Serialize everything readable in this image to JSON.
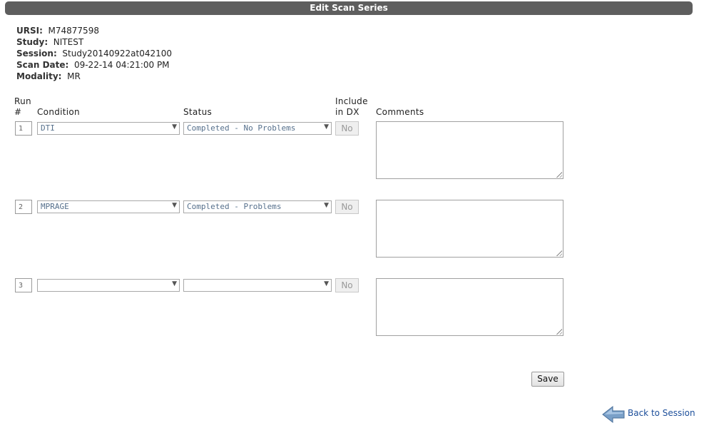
{
  "title": "Edit Scan Series",
  "info": [
    {
      "label": "URSI:",
      "value": "M74877598"
    },
    {
      "label": "Study:",
      "value": "NITEST"
    },
    {
      "label": "Session:",
      "value": "Study20140922at042100"
    },
    {
      "label": "Scan Date:",
      "value": "09-22-14 04:21:00 PM"
    },
    {
      "label": "Modality:",
      "value": "MR"
    }
  ],
  "headers": {
    "run_line1": "Run",
    "run_line2": "#",
    "condition": "Condition",
    "status": "Status",
    "include_line1": "Include",
    "include_line2": "in DX",
    "comments": "Comments"
  },
  "rows": [
    {
      "run": "1",
      "condition": "DTI",
      "status": "Completed - No Problems",
      "include": "No",
      "comments": ""
    },
    {
      "run": "2",
      "condition": "MPRAGE",
      "status": "Completed - Problems",
      "include": "No",
      "comments": ""
    },
    {
      "run": "3",
      "condition": "",
      "status": "",
      "include": "No",
      "comments": ""
    }
  ],
  "save_label": "Save",
  "back_label": "Back to Session",
  "icons": {
    "dropdown": "chevron-down-icon",
    "back": "back-arrow-icon"
  }
}
